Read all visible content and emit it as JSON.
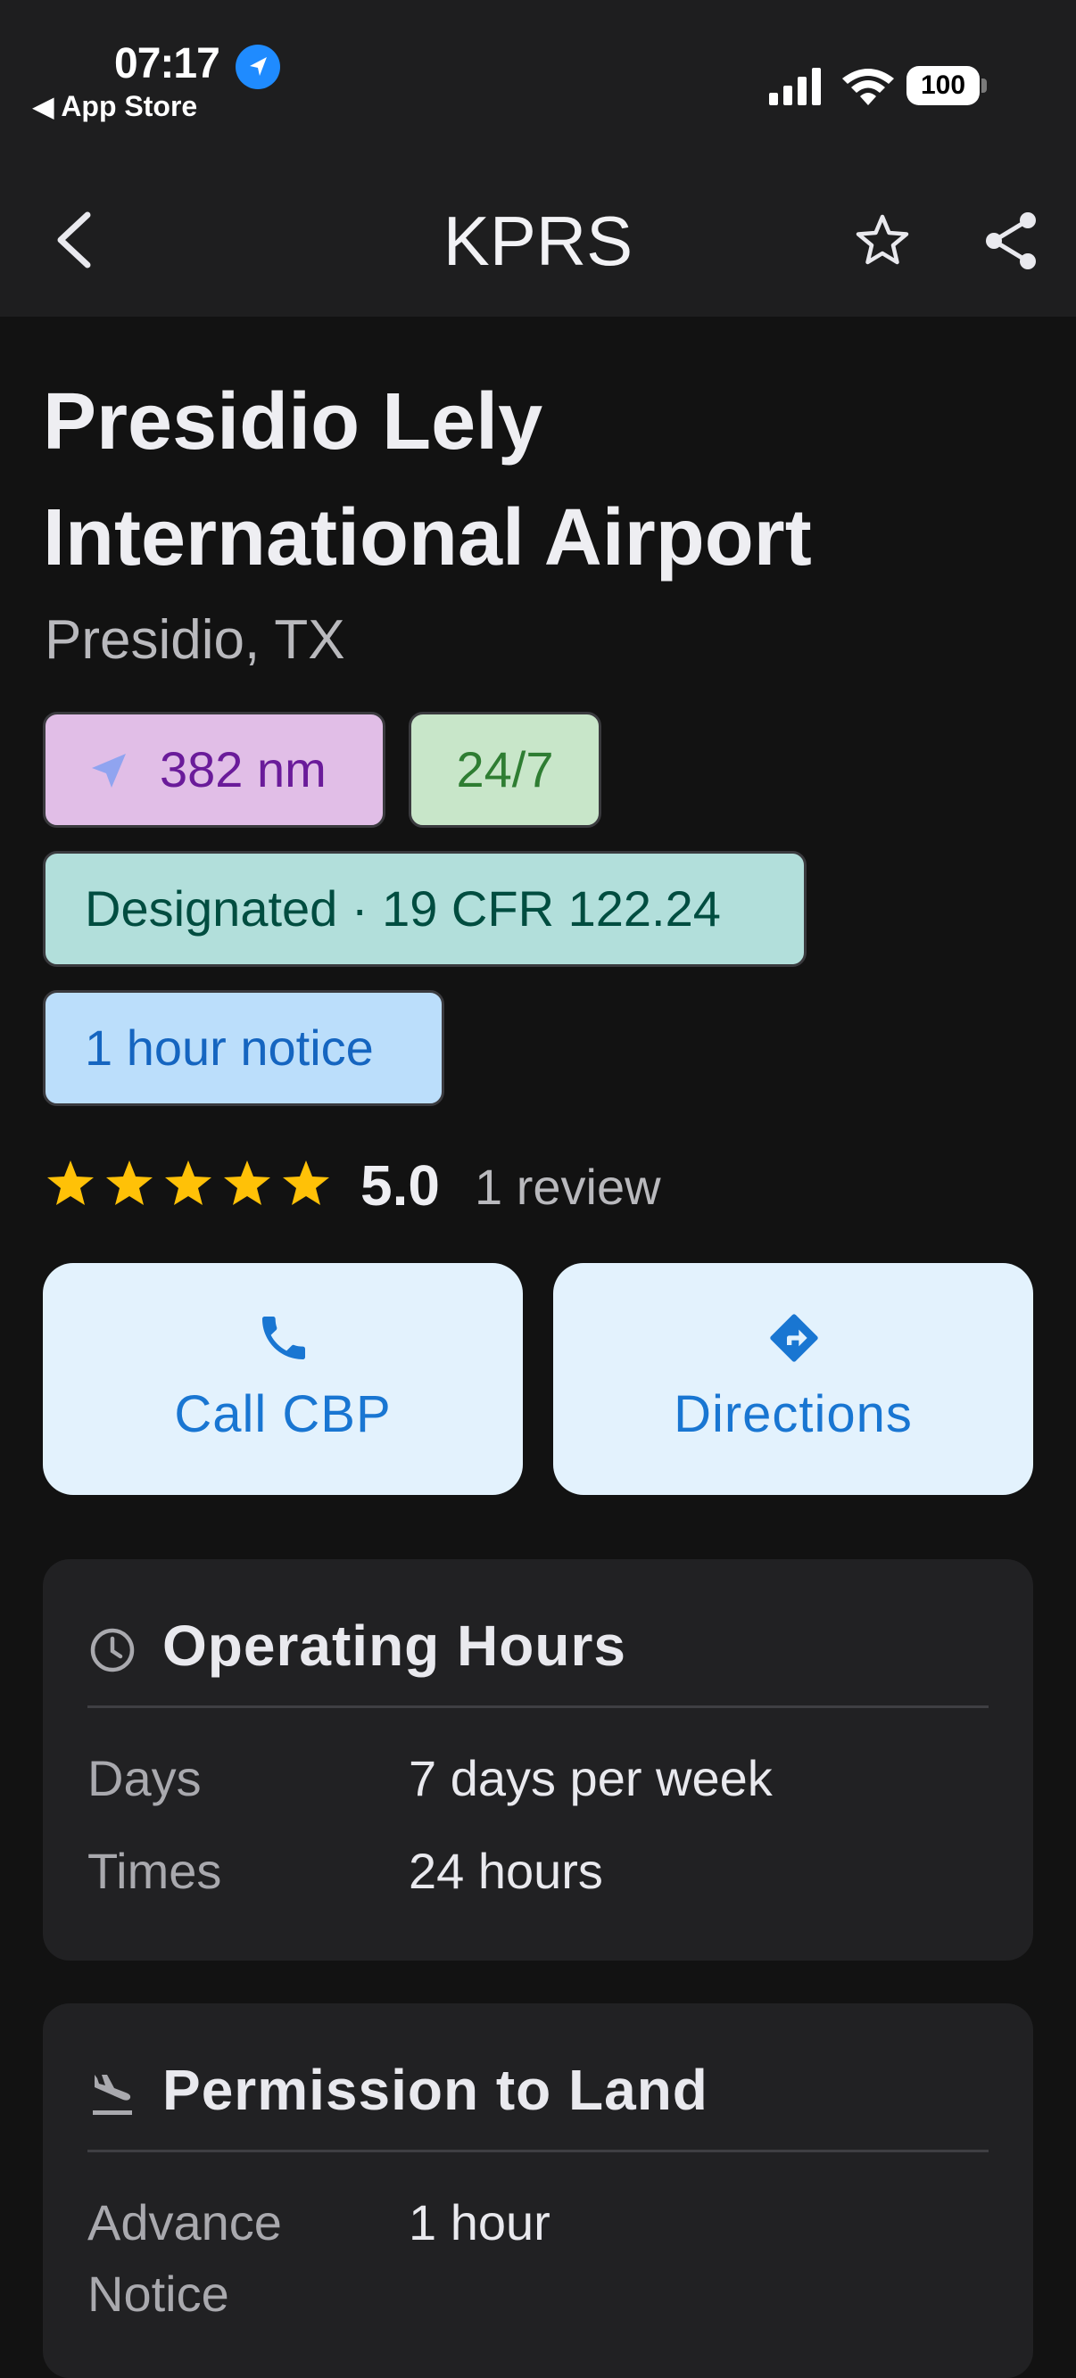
{
  "status_bar": {
    "time": "07:17",
    "back_app": "◀ App Store",
    "battery": "100"
  },
  "nav": {
    "title": "KPRS"
  },
  "airport": {
    "name": "Presidio Lely International Airport",
    "location": "Presidio, TX"
  },
  "chips": {
    "distance": "382 nm",
    "hours": "24/7",
    "designation": "Designated · 19 CFR 122.24",
    "notice": "1 hour notice"
  },
  "rating": {
    "stars": 5,
    "value": "5.0",
    "count": "1 review",
    "star_color": "#ffc107"
  },
  "actions": {
    "call_label": "Call CBP",
    "directions_label": "Directions"
  },
  "operating_hours": {
    "title": "Operating Hours",
    "rows": [
      {
        "label": "Days",
        "value": "7 days per week"
      },
      {
        "label": "Times",
        "value": "24 hours"
      }
    ]
  },
  "permission": {
    "title": "Permission to Land",
    "rows": [
      {
        "label": "Advance Notice",
        "value": "1 hour"
      }
    ]
  },
  "colors": {
    "background": "#121212",
    "bar": "#1e1e1f",
    "card": "#212123",
    "accent": "#1976d2"
  }
}
